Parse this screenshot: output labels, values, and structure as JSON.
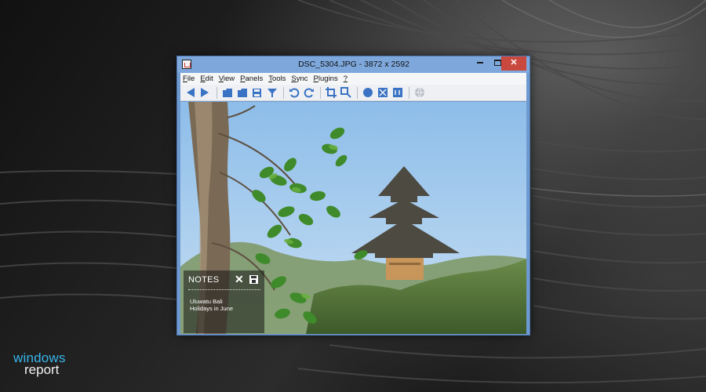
{
  "window": {
    "title": "DSC_5304.JPG  -  3872 x 2592",
    "close_glyph": "✕"
  },
  "menu": [
    {
      "label": "File",
      "accel": "F",
      "rest": "ile"
    },
    {
      "label": "Edit",
      "accel": "E",
      "rest": "dit"
    },
    {
      "label": "View",
      "accel": "V",
      "rest": "iew"
    },
    {
      "label": "Panels",
      "accel": "P",
      "rest": "anels"
    },
    {
      "label": "Tools",
      "accel": "T",
      "rest": "ools"
    },
    {
      "label": "Sync",
      "accel": "S",
      "rest": "ync"
    },
    {
      "label": "Plugins",
      "accel": "P",
      "rest": "lugins"
    },
    {
      "label": "?",
      "accel": "?",
      "rest": ""
    }
  ],
  "toolbar": {
    "icons": [
      "previous-arrow-icon",
      "next-arrow-icon",
      "open-folder-icon",
      "open-folder-2-icon",
      "save-icon",
      "save-as-icon",
      "rotate-left-icon",
      "rotate-right-icon",
      "crop-icon",
      "resize-icon",
      "zoom-in-icon",
      "fit-screen-icon",
      "actual-size-icon",
      "web-icon"
    ],
    "accent": "#3a73c4"
  },
  "notes": {
    "title": "NOTES",
    "close_glyph": "✕",
    "text_line1": "Uluwatu Bali",
    "text_line2": "Holidays in June"
  },
  "brand": {
    "line1": "windows",
    "line2": "report",
    "accent": "#39b5ea"
  },
  "colors": {
    "titlebar": "#7ea8dc",
    "close_button": "#c9493e",
    "sky": "#a9cdf0"
  }
}
